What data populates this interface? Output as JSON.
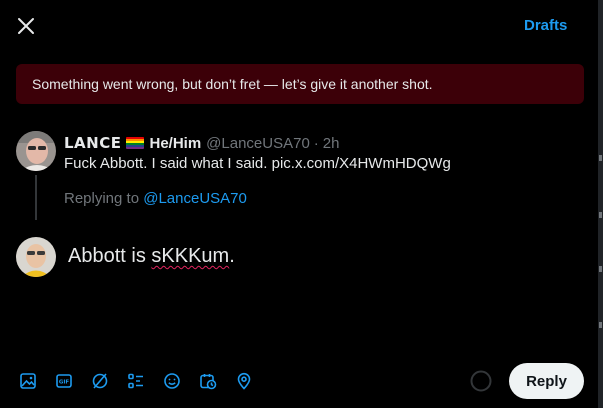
{
  "header": {
    "drafts_label": "Drafts",
    "close_icon": "close-icon"
  },
  "alert": {
    "message": "Something went wrong, but don’t fret — let’s give it another shot."
  },
  "quoted_tweet": {
    "display_name": "LANCE",
    "flag_icon": "rainbow-flag-icon",
    "pronouns": "He/Him",
    "handle": "@LanceUSA70",
    "separator": "·",
    "time": "2h",
    "text": "Fuck Abbott. I said what I said. pic.x.com/X4HWmHDQWg"
  },
  "replying": {
    "prefix": "Replying to ",
    "handle": "@LanceUSA70"
  },
  "composer": {
    "text_before": "Abbott is ",
    "misspelled_word": "sKKKum",
    "text_after": "."
  },
  "toolbar": {
    "icons": [
      "image-icon",
      "gif-icon",
      "grok-icon",
      "poll-icon",
      "emoji-icon",
      "schedule-icon",
      "location-icon"
    ],
    "reply_label": "Reply"
  },
  "colors": {
    "accent": "#1d9bf0",
    "error_bg": "#3c0008",
    "background": "#000000",
    "muted": "#71767b"
  }
}
